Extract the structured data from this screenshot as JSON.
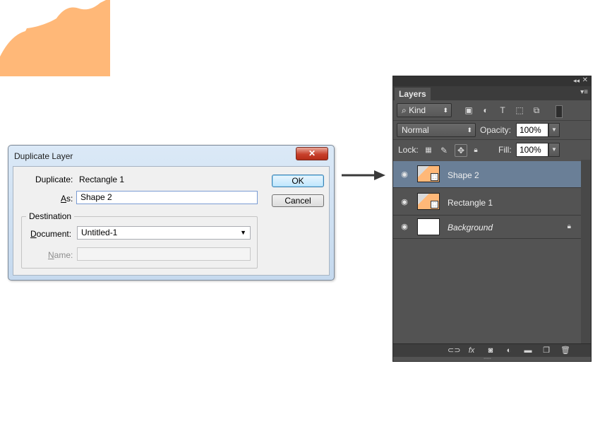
{
  "dialog": {
    "title": "Duplicate Layer",
    "close_glyph": "✕",
    "duplicate_label": "Duplicate:",
    "duplicate_value": "Rectangle 1",
    "as_label": "As:",
    "as_value": "Shape 2",
    "destination_label": "Destination",
    "document_label": "Document:",
    "document_value": "Untitled-1",
    "name_label": "Name:",
    "name_value": "",
    "ok_label": "OK",
    "cancel_label": "Cancel"
  },
  "panel": {
    "tab_label": "Layers",
    "filter_kind": "Kind",
    "blend_mode": "Normal",
    "opacity_label": "Opacity:",
    "opacity_value": "100%",
    "lock_label": "Lock:",
    "fill_label": "Fill:",
    "fill_value": "100%",
    "layers": [
      {
        "name": "Shape 2",
        "selected": true,
        "italic": false,
        "locked": false
      },
      {
        "name": "Rectangle 1",
        "selected": false,
        "italic": false,
        "locked": false
      },
      {
        "name": "Background",
        "selected": false,
        "italic": true,
        "locked": true
      }
    ]
  },
  "colors": {
    "shape_orange": "#ffb878",
    "panel_bg": "#535353",
    "selected_layer": "#6a7f97"
  }
}
